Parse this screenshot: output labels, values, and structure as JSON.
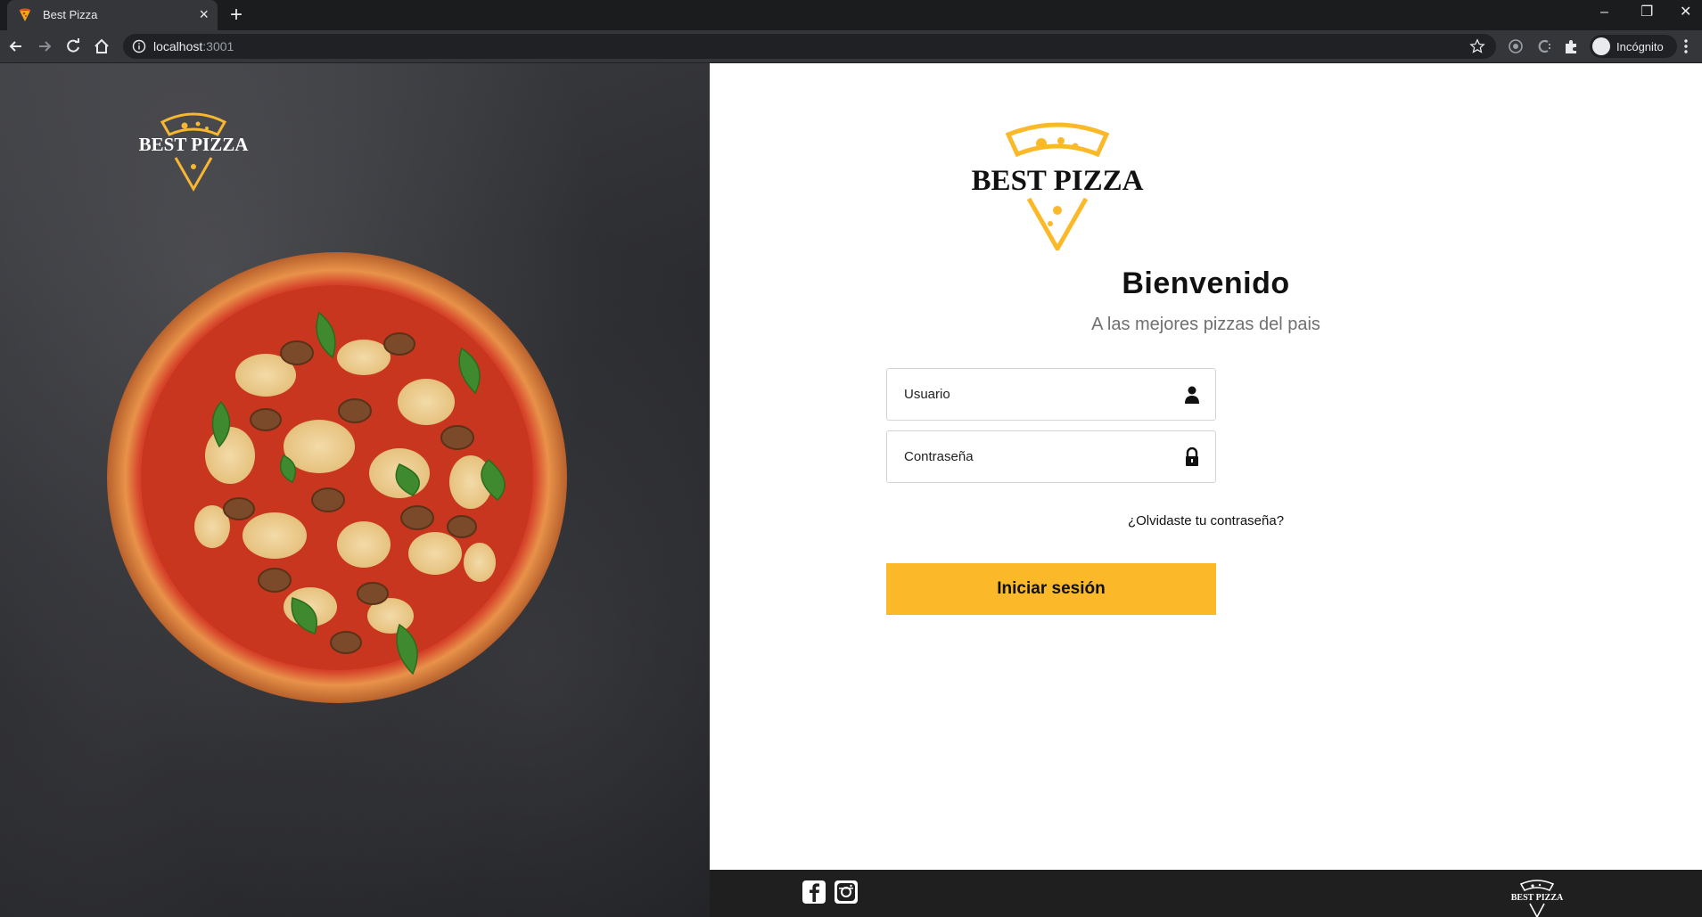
{
  "browser": {
    "tab_title": "Best Pizza",
    "tab_close": "×",
    "new_tab": "+",
    "url_host": "localhost",
    "url_port": ":3001",
    "incognito_label": "Incógnito",
    "window_controls": [
      "–",
      "❐",
      "✕"
    ]
  },
  "brand": {
    "logo_text": "BEST PIZZA",
    "accent_color": "#fbb929",
    "footer_bg": "#1f1f1f"
  },
  "login": {
    "title": "Bienvenido",
    "subtitle": "A las mejores pizzas del pais",
    "username_placeholder": "Usuario",
    "password_placeholder": "Contraseña",
    "forgot_link": "¿Olvidaste tu contraseña?",
    "submit_label": "Iniciar sesión"
  },
  "footer": {
    "social": [
      "facebook-icon",
      "instagram-icon"
    ]
  }
}
